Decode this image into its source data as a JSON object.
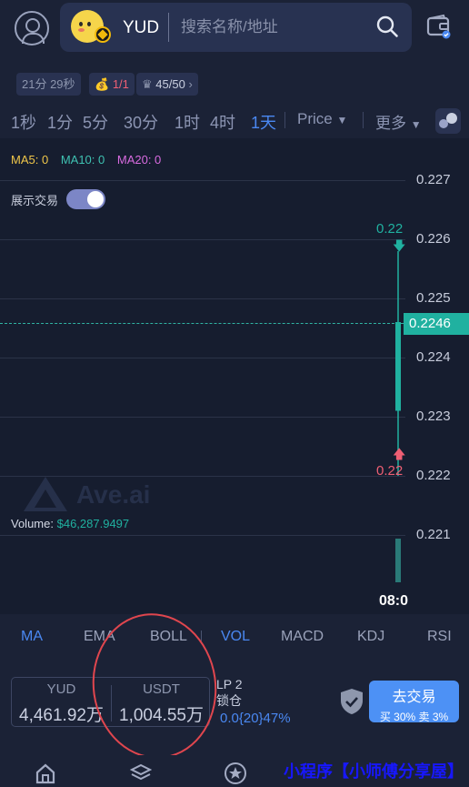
{
  "header": {
    "token_symbol": "YUD",
    "search_placeholder": "搜索名称/地址",
    "logo_text": "Ave.ai"
  },
  "stats": {
    "age": "21分 29秒",
    "holders_label": "1/1",
    "rank": "45/50",
    "rank_chevron": "›"
  },
  "timeframes": {
    "items": [
      "1秒",
      "1分",
      "5分",
      "30分",
      "1时",
      "4时",
      "1天"
    ],
    "active": "1天",
    "price_label": "Price",
    "more_label": "更多"
  },
  "indicators_top": {
    "ma5": "MA5: 0",
    "ma10": "MA10: 0",
    "ma20": "MA20: 0"
  },
  "toggle": {
    "label": "展示交易",
    "on": true
  },
  "chart_data": {
    "type": "candlestick",
    "y_ticks": [
      "0.227",
      "0.226",
      "0.225",
      "0.224",
      "0.223",
      "0.222",
      "0.221"
    ],
    "ylim": [
      0.2205,
      0.2272
    ],
    "current_price": "0.2246",
    "high_marker": "0.22",
    "low_marker": "0.22",
    "candles": [
      {
        "open": 0.2231,
        "close": 0.2246,
        "high": 0.2258,
        "low": 0.222
      }
    ],
    "volume_label": "Volume:",
    "volume_value": "$46,287.9497",
    "x_labels": [
      "08:0"
    ]
  },
  "indicator_tabs": {
    "items": [
      "MA",
      "EMA",
      "BOLL",
      "VOL",
      "MACD",
      "KDJ",
      "RSI"
    ],
    "active": [
      "MA",
      "VOL"
    ]
  },
  "balances": {
    "token_header": "YUD",
    "token_value": "4,461.92万",
    "quote_header": "USDT",
    "quote_value": "1,004.55万"
  },
  "lp": {
    "label_line1": "LP 2",
    "label_line2": "锁仓",
    "value": "0.0{20}47%"
  },
  "trade": {
    "button_label": "去交易",
    "tax": "买 30% 卖 3%"
  },
  "overlay": {
    "mini_program_text": "小程序【小师傅分享屋】"
  },
  "colors": {
    "up": "#20b1a0",
    "down": "#ef5f74",
    "accent": "#4a88f2",
    "annotation_circle": "#e0464e"
  }
}
